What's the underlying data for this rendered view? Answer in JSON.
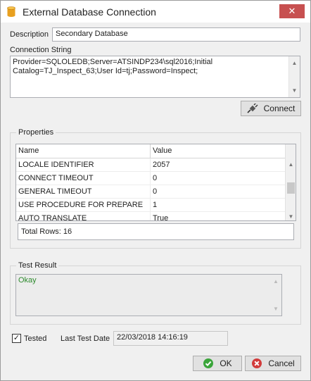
{
  "window": {
    "title": "External Database Connection",
    "close_glyph": "✕"
  },
  "description": {
    "label": "Description",
    "value": "Secondary Database"
  },
  "connection_string": {
    "label": "Connection String",
    "line1": "Provider=SQLOLEDB;Server=ATSINDP234\\sql2016;Initial",
    "line2": "Catalog=TJ_Inspect_63;User Id=tj;Password=Inspect;"
  },
  "connect_button": {
    "label": "Connect",
    "icon": "plug-icon"
  },
  "properties": {
    "legend": "Properties",
    "columns": [
      "Name",
      "Value"
    ],
    "rows": [
      {
        "name": "LOCALE IDENTIFIER",
        "value": "2057"
      },
      {
        "name": "CONNECT TIMEOUT",
        "value": "0"
      },
      {
        "name": "GENERAL TIMEOUT",
        "value": "0"
      },
      {
        "name": "USE PROCEDURE FOR PREPARE",
        "value": "1"
      },
      {
        "name": "AUTO TRANSLATE",
        "value": "True"
      }
    ],
    "total_rows": "Total Rows: 16"
  },
  "test_result": {
    "legend": "Test Result",
    "text": "Okay",
    "text_color": "#2e8b2e"
  },
  "tested": {
    "checked": true,
    "label": "Tested",
    "check_glyph": "✓"
  },
  "last_test_date": {
    "label": "Last Test Date",
    "value": "22/03/2018 14:16:19"
  },
  "ok_button": {
    "label": "OK",
    "icon": "check-circle-icon",
    "icon_color": "#3aa53a"
  },
  "cancel_button": {
    "label": "Cancel",
    "icon": "cancel-circle-icon",
    "icon_color": "#d23b3b"
  },
  "scroll_arrows": {
    "up": "▲",
    "down": "▼"
  }
}
